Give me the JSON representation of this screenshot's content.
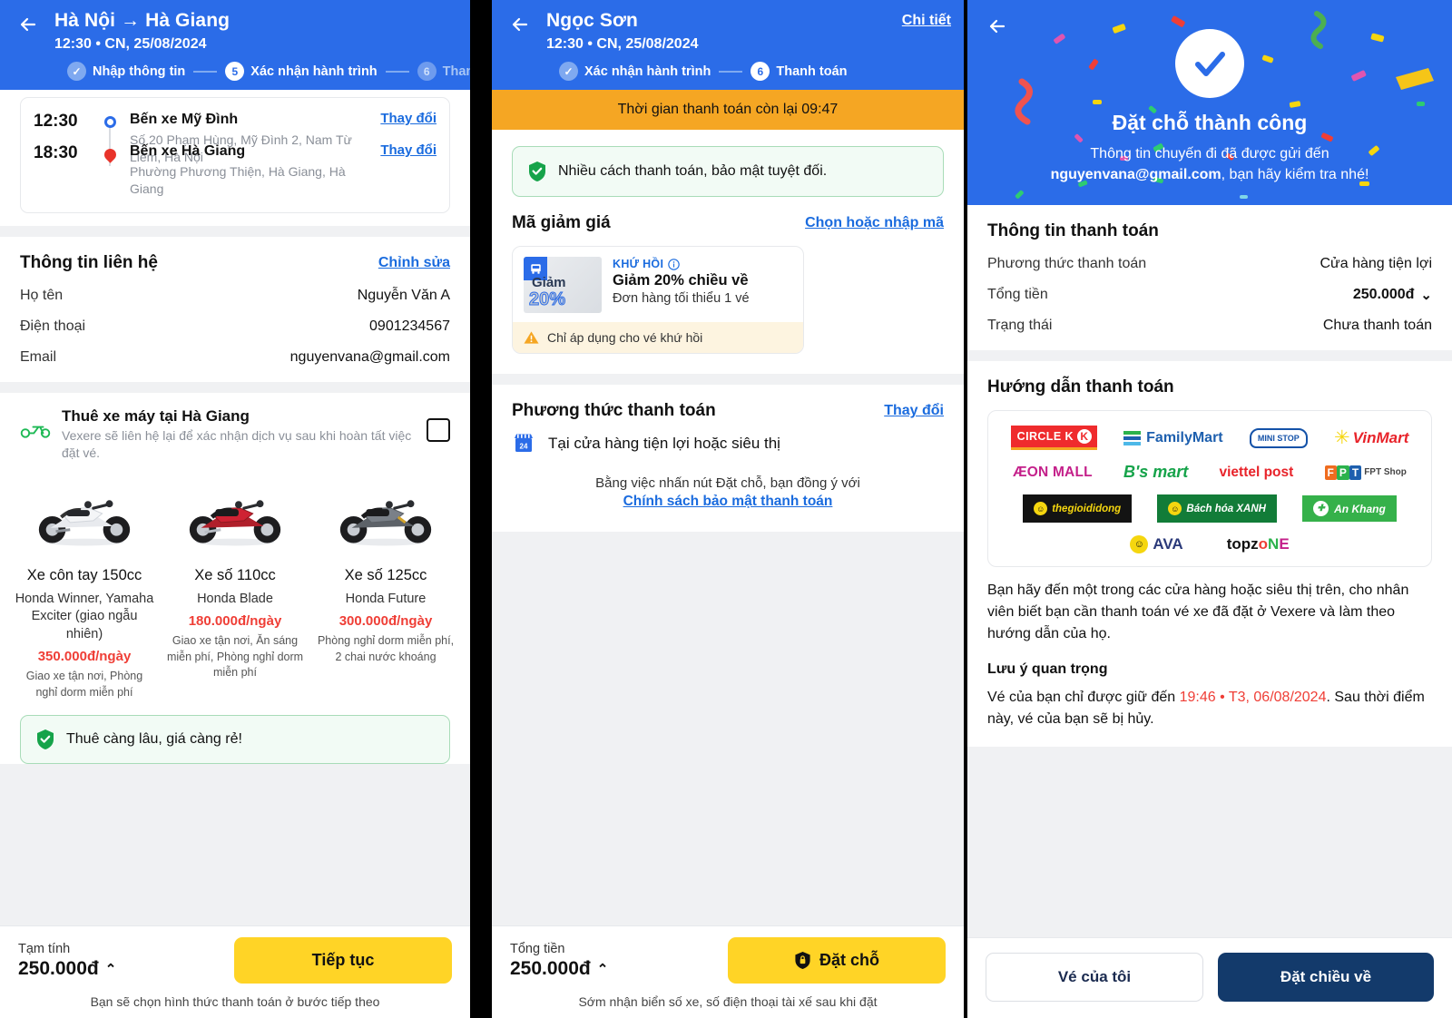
{
  "panel1": {
    "header": {
      "back_icon": "arrow-left-icon",
      "title": "Hà Nội → Hà Giang",
      "subtitle": "12:30 • CN, 25/08/2024",
      "steps": [
        {
          "label": "Nhập thông tin",
          "number": "✓",
          "state": "done"
        },
        {
          "label": "Xác nhận hành trình",
          "number": "5",
          "state": "active"
        },
        {
          "label": "Thanh toán",
          "number": "6",
          "state": "todo"
        }
      ]
    },
    "trip": {
      "change_label": "Thay đổi",
      "stops": [
        {
          "time": "12:30",
          "name": "Bến xe Mỹ Đình",
          "address": "Số 20 Phạm Hùng, Mỹ Đình 2, Nam Từ Liêm, Hà Nội"
        },
        {
          "time": "18:30",
          "name": "Bến xe Hà Giang",
          "address": "Phường Phương Thiện, Hà Giang, Hà Giang"
        }
      ]
    },
    "contact": {
      "title": "Thông tin liên hệ",
      "edit_label": "Chỉnh sửa",
      "rows": [
        {
          "key": "Họ tên",
          "value": "Nguyễn Văn A"
        },
        {
          "key": "Điện thoại",
          "value": "0901234567"
        },
        {
          "key": "Email",
          "value": "nguyenvana@gmail.com"
        }
      ]
    },
    "moto": {
      "icon": "motorbike-icon",
      "title": "Thuê xe máy tại Hà Giang",
      "desc": "Vexere sẽ liên hệ lại để xác nhận dịch vụ sau khi hoàn tất việc đặt vé.",
      "bikes": [
        {
          "name": "Xe côn tay 150cc",
          "model": "Honda Winner, Yamaha Exciter (giao ngẫu nhiên)",
          "price": "350.000đ/ngày",
          "perks": "Giao xe tận nơi, Phòng nghỉ dorm miễn phí"
        },
        {
          "name": "Xe số 110cc",
          "model": "Honda Blade",
          "price": "180.000đ/ngày",
          "perks": "Giao xe tận nơi, Ăn sáng miễn phí, Phòng nghỉ dorm miễn phí"
        },
        {
          "name": "Xe số 125cc",
          "model": "Honda Future",
          "price": "300.000đ/ngày",
          "perks": "Phòng nghỉ dorm miễn phí, 2 chai nước khoáng"
        }
      ],
      "notice": "Thuê càng lâu, giá càng rẻ!",
      "notice_icon": "shield-check-icon"
    },
    "footer": {
      "label": "Tạm tính",
      "amount": "250.000đ",
      "caret": "⌃",
      "button": "Tiếp tục",
      "note": "Bạn sẽ chọn hình thức thanh toán ở bước tiếp theo"
    }
  },
  "panel2": {
    "header": {
      "back_icon": "arrow-left-icon",
      "title": "Ngọc Sơn",
      "subtitle": "12:30 • CN, 25/08/2024",
      "detail_link": "Chi tiết",
      "steps": [
        {
          "label": "Xác nhận hành trình",
          "number": "✓",
          "state": "done"
        },
        {
          "label": "Thanh toán",
          "number": "6",
          "state": "active"
        }
      ]
    },
    "timer": "Thời gian thanh toán còn lại 09:47",
    "secure_notice": "Nhiều cách thanh toán, bảo mật tuyệt đối.",
    "secure_icon": "shield-check-icon",
    "promo": {
      "title": "Mã giảm giá",
      "link": "Chọn hoặc nhập mã",
      "voucher": {
        "thumb_line1": "Giảm",
        "thumb_line2": "20%",
        "thumb_icon": "bus-icon",
        "tag": "KHỨ HỒI",
        "tag_icon": "info-icon",
        "title": "Giảm 20% chiều về",
        "subtitle": "Đơn hàng tối thiểu 1 vé",
        "warning": "Chỉ áp dụng cho vé khứ hồi",
        "warning_icon": "warning-icon"
      }
    },
    "payment": {
      "title": "Phương thức thanh toán",
      "change_link": "Thay đổi",
      "method_icon": "store-icon",
      "method_label": "Tại cửa hàng tiện lợi hoặc siêu thị",
      "agree_line": "Bằng việc nhấn nút Đặt chỗ, bạn đồng ý với",
      "agree_link": "Chính sách bảo mật thanh toán"
    },
    "footer": {
      "label": "Tổng tiền",
      "amount": "250.000đ",
      "caret": "⌃",
      "button": "Đặt chỗ",
      "button_icon": "lock-shield-icon",
      "note": "Sớm nhận biển số xe, số điện thoại tài xế sau khi đặt"
    }
  },
  "panel3": {
    "hero": {
      "back_icon": "arrow-left-icon",
      "check_icon": "check-circle-icon",
      "title": "Đặt chỗ thành công",
      "line1": "Thông tin chuyến đi đã được gửi đến",
      "email": "nguyenvana@gmail.com",
      "line2": ", bạn hãy kiểm tra nhé!"
    },
    "payinfo": {
      "title": "Thông tin thanh toán",
      "rows": [
        {
          "key": "Phương thức thanh toán",
          "value": "Cửa hàng tiện lợi",
          "style": "normal"
        },
        {
          "key": "Tổng tiền",
          "value": "250.000đ",
          "style": "bold",
          "caret": "⌄"
        },
        {
          "key": "Trạng thái",
          "value": "Chưa thanh toán",
          "style": "red"
        }
      ]
    },
    "guide": {
      "title": "Hướng dẫn thanh toán",
      "logos_row1": [
        "CIRCLE K",
        "FamilyMart",
        "MINI STOP",
        "VinMart"
      ],
      "logos_row2": [
        "ÆON MALL",
        "B's mart",
        "viettel post",
        "FPT Shop"
      ],
      "logos_row3": [
        "thegioididong",
        "Bách hóa XANH",
        "An Khang"
      ],
      "logos_row4": [
        "AVA",
        "topzone"
      ],
      "paragraph": "Bạn hãy đến một trong các cửa hàng hoặc siêu thị trên, cho nhân viên biết bạn cần thanh toán vé xe đã đặt ở Vexere và làm theo hướng dẫn của họ.",
      "note_title": "Lưu ý quan trọng",
      "note_pre": "Vé của bạn chỉ được giữ đến ",
      "note_deadline": "19:46 • T3, 06/08/2024",
      "note_post": ". Sau thời điểm này, vé của bạn sẽ bị hủy."
    },
    "footer": {
      "secondary": "Vé của tôi",
      "primary": "Đặt chiều về"
    }
  },
  "colors": {
    "brand_blue": "#2b6ce8",
    "yellow": "#ffd426",
    "navy": "#133a6b",
    "red": "#ef3e36",
    "green": "#16a34a",
    "orange": "#f5a623"
  }
}
